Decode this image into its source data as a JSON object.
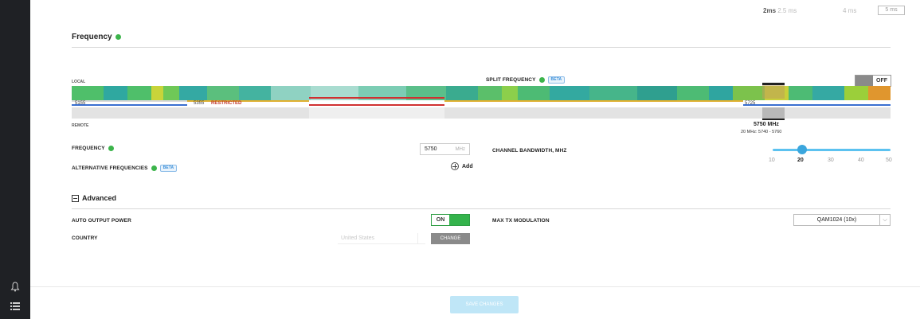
{
  "topbar": {
    "opt_2ms": "2ms",
    "opt_2_5ms": "2.5 ms",
    "opt_4ms": "4 ms",
    "opt_5ms": "5 ms"
  },
  "frequency_section": {
    "title": "Frequency",
    "split_label": "SPLIT FREQUENCY",
    "split_beta": "BETA",
    "split_toggle": "OFF",
    "local_label": "LOCAL",
    "remote_label": "REMOTE",
    "band_start": "5155",
    "restricted_start": "5355",
    "restricted_label": "RESTRICTED",
    "band_resume": "5725",
    "selected_freq": "5750 MHz",
    "selected_range": "20 MHz: 5740 - 5760"
  },
  "frequency_field": {
    "label": "FREQUENCY",
    "value": "5750",
    "unit": "MHz"
  },
  "alt_freq": {
    "label": "ALTERNATIVE FREQUENCIES",
    "beta": "BETA",
    "add_label": "Add"
  },
  "bandwidth": {
    "label": "CHANNEL BANDWIDTH, MHz",
    "ticks": [
      "10",
      "20",
      "30",
      "40",
      "50"
    ],
    "selected": "20"
  },
  "advanced": {
    "title": "Advanced",
    "auto_power_label": "AUTO OUTPUT POWER",
    "auto_power_toggle": "ON",
    "max_tx_label": "MAX TX MODULATION",
    "max_tx_value": "QAM1024 (10x)",
    "country_label": "COUNTRY",
    "country_value": "United States",
    "change_label": "CHANGE"
  },
  "footer": {
    "save_label": "SAVE CHANGES"
  },
  "colors": {
    "accent_green": "#3cb44b",
    "accent_blue": "#3ba6dd",
    "sidebar": "#1f2125"
  },
  "icons": {
    "bell": "bell-icon",
    "list": "list-icon"
  }
}
